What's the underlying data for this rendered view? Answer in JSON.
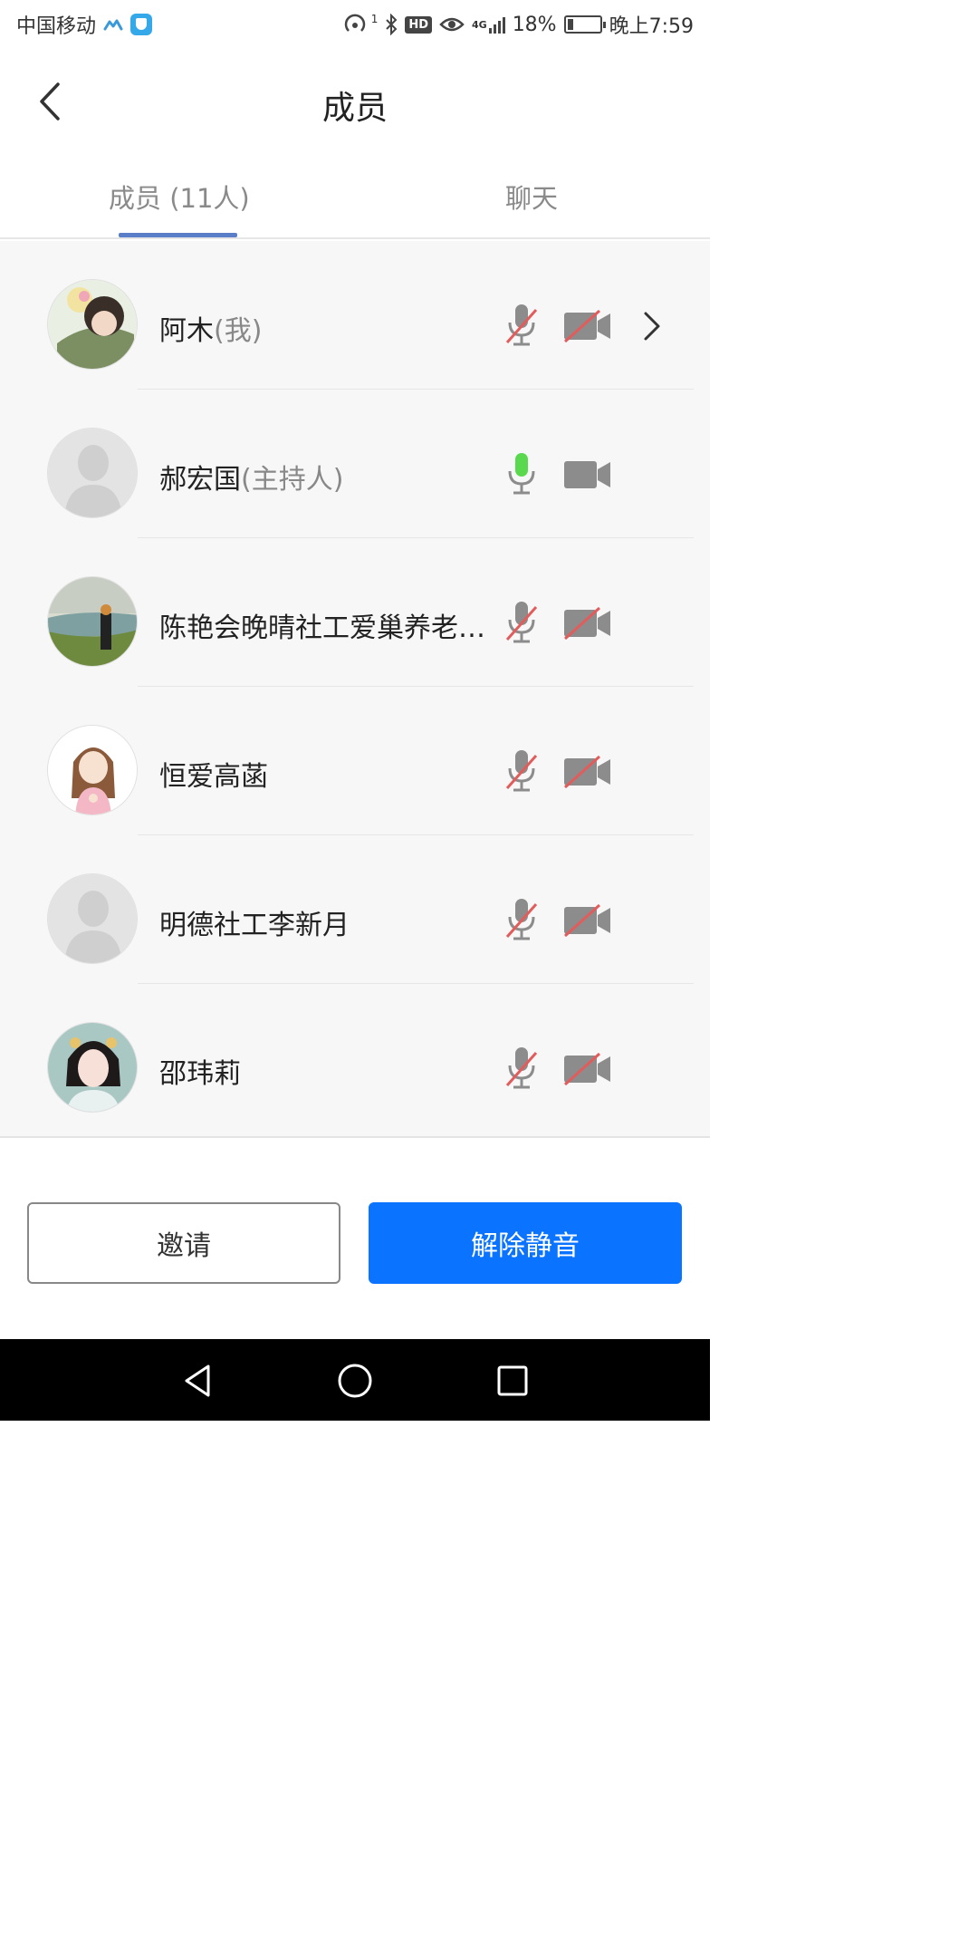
{
  "status_bar": {
    "carrier": "中国移动",
    "signal_tag": "4G",
    "sim_index": "1",
    "hd": "HD",
    "battery": "18%",
    "battery_level": 0.18,
    "time": "晚上7:59"
  },
  "header": {
    "title": "成员"
  },
  "tabs": [
    {
      "label": "成员 (11人)",
      "active": true
    },
    {
      "label": "聊天",
      "active": false
    }
  ],
  "members": [
    {
      "name": "阿木",
      "role": "(我)",
      "avatar": "photo-flowers",
      "mic": "muted",
      "camera": "off",
      "has_detail": true
    },
    {
      "name": "郝宏国",
      "role": "(主持人)",
      "avatar": "default-silhouette",
      "mic": "speaking",
      "camera": "on",
      "has_detail": false
    },
    {
      "name": "陈艳会晚晴社工爱巢养老…",
      "role": "",
      "avatar": "photo-riverside",
      "mic": "muted",
      "camera": "off",
      "has_detail": false
    },
    {
      "name": "恒爱高菡",
      "role": "",
      "avatar": "cartoon-girl",
      "mic": "muted",
      "camera": "off",
      "has_detail": false
    },
    {
      "name": "明德社工李新月",
      "role": "",
      "avatar": "default-silhouette",
      "mic": "muted",
      "camera": "off",
      "has_detail": false
    },
    {
      "name": "邵玮莉",
      "role": "",
      "avatar": "photo-portrait",
      "mic": "muted",
      "camera": "off",
      "has_detail": false
    }
  ],
  "actions": {
    "invite": "邀请",
    "unmute": "解除静音"
  },
  "colors": {
    "accent": "#0a73ff",
    "tab_indicator": "#5b7ec9",
    "mic_active": "#5ad94f",
    "muted_slash": "#e25c5c",
    "icon_gray": "#8c8c8c"
  }
}
